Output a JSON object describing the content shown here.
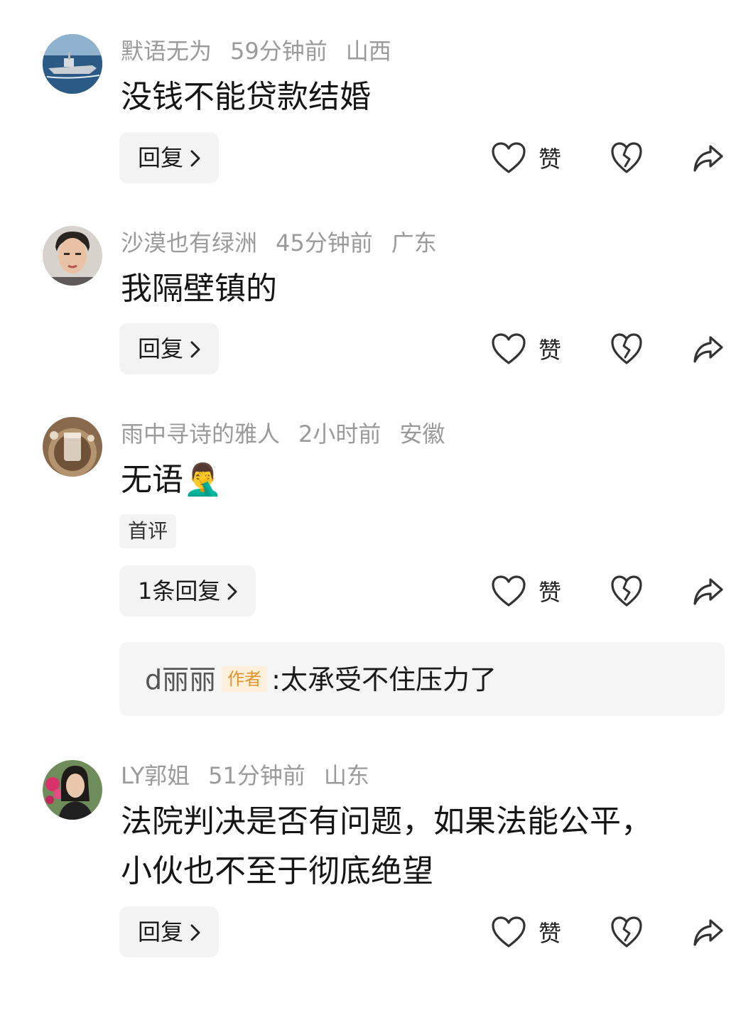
{
  "comments": [
    {
      "username": "默语无为",
      "time": "59分钟前",
      "location": "山西",
      "text": "没钱不能贷款结婚",
      "reply_label": "回复",
      "like_label": "赞",
      "avatar": "warship-avatar"
    },
    {
      "username": "沙漠也有绿洲",
      "time": "45分钟前",
      "location": "广东",
      "text": "我隔壁镇的",
      "reply_label": "回复",
      "like_label": "赞",
      "avatar": "young-man-avatar"
    },
    {
      "username": "雨中寻诗的雅人",
      "time": "2小时前",
      "location": "安徽",
      "text": "无语",
      "emoji": "🤦‍♂️",
      "tag": "首评",
      "reply_label": "1条回复",
      "like_label": "赞",
      "avatar": "milk-tea-avatar",
      "sub_reply": {
        "username": "d丽丽",
        "badge": "作者",
        "separator": ":",
        "text": "太承受不住压力了"
      }
    },
    {
      "username": "LY郭姐",
      "time": "51分钟前",
      "location": "山东",
      "text_line1": "法院判决是否有问题，如果法能公平，",
      "text_line2": "小伙也不至于彻底绝望",
      "reply_label": "回复",
      "like_label": "赞",
      "avatar": "woman-flowers-avatar"
    }
  ],
  "icons": {
    "like": "heart-outline-icon",
    "dislike": "broken-heart-icon",
    "share": "share-arrow-icon",
    "chevron": "chevron-right-icon"
  }
}
